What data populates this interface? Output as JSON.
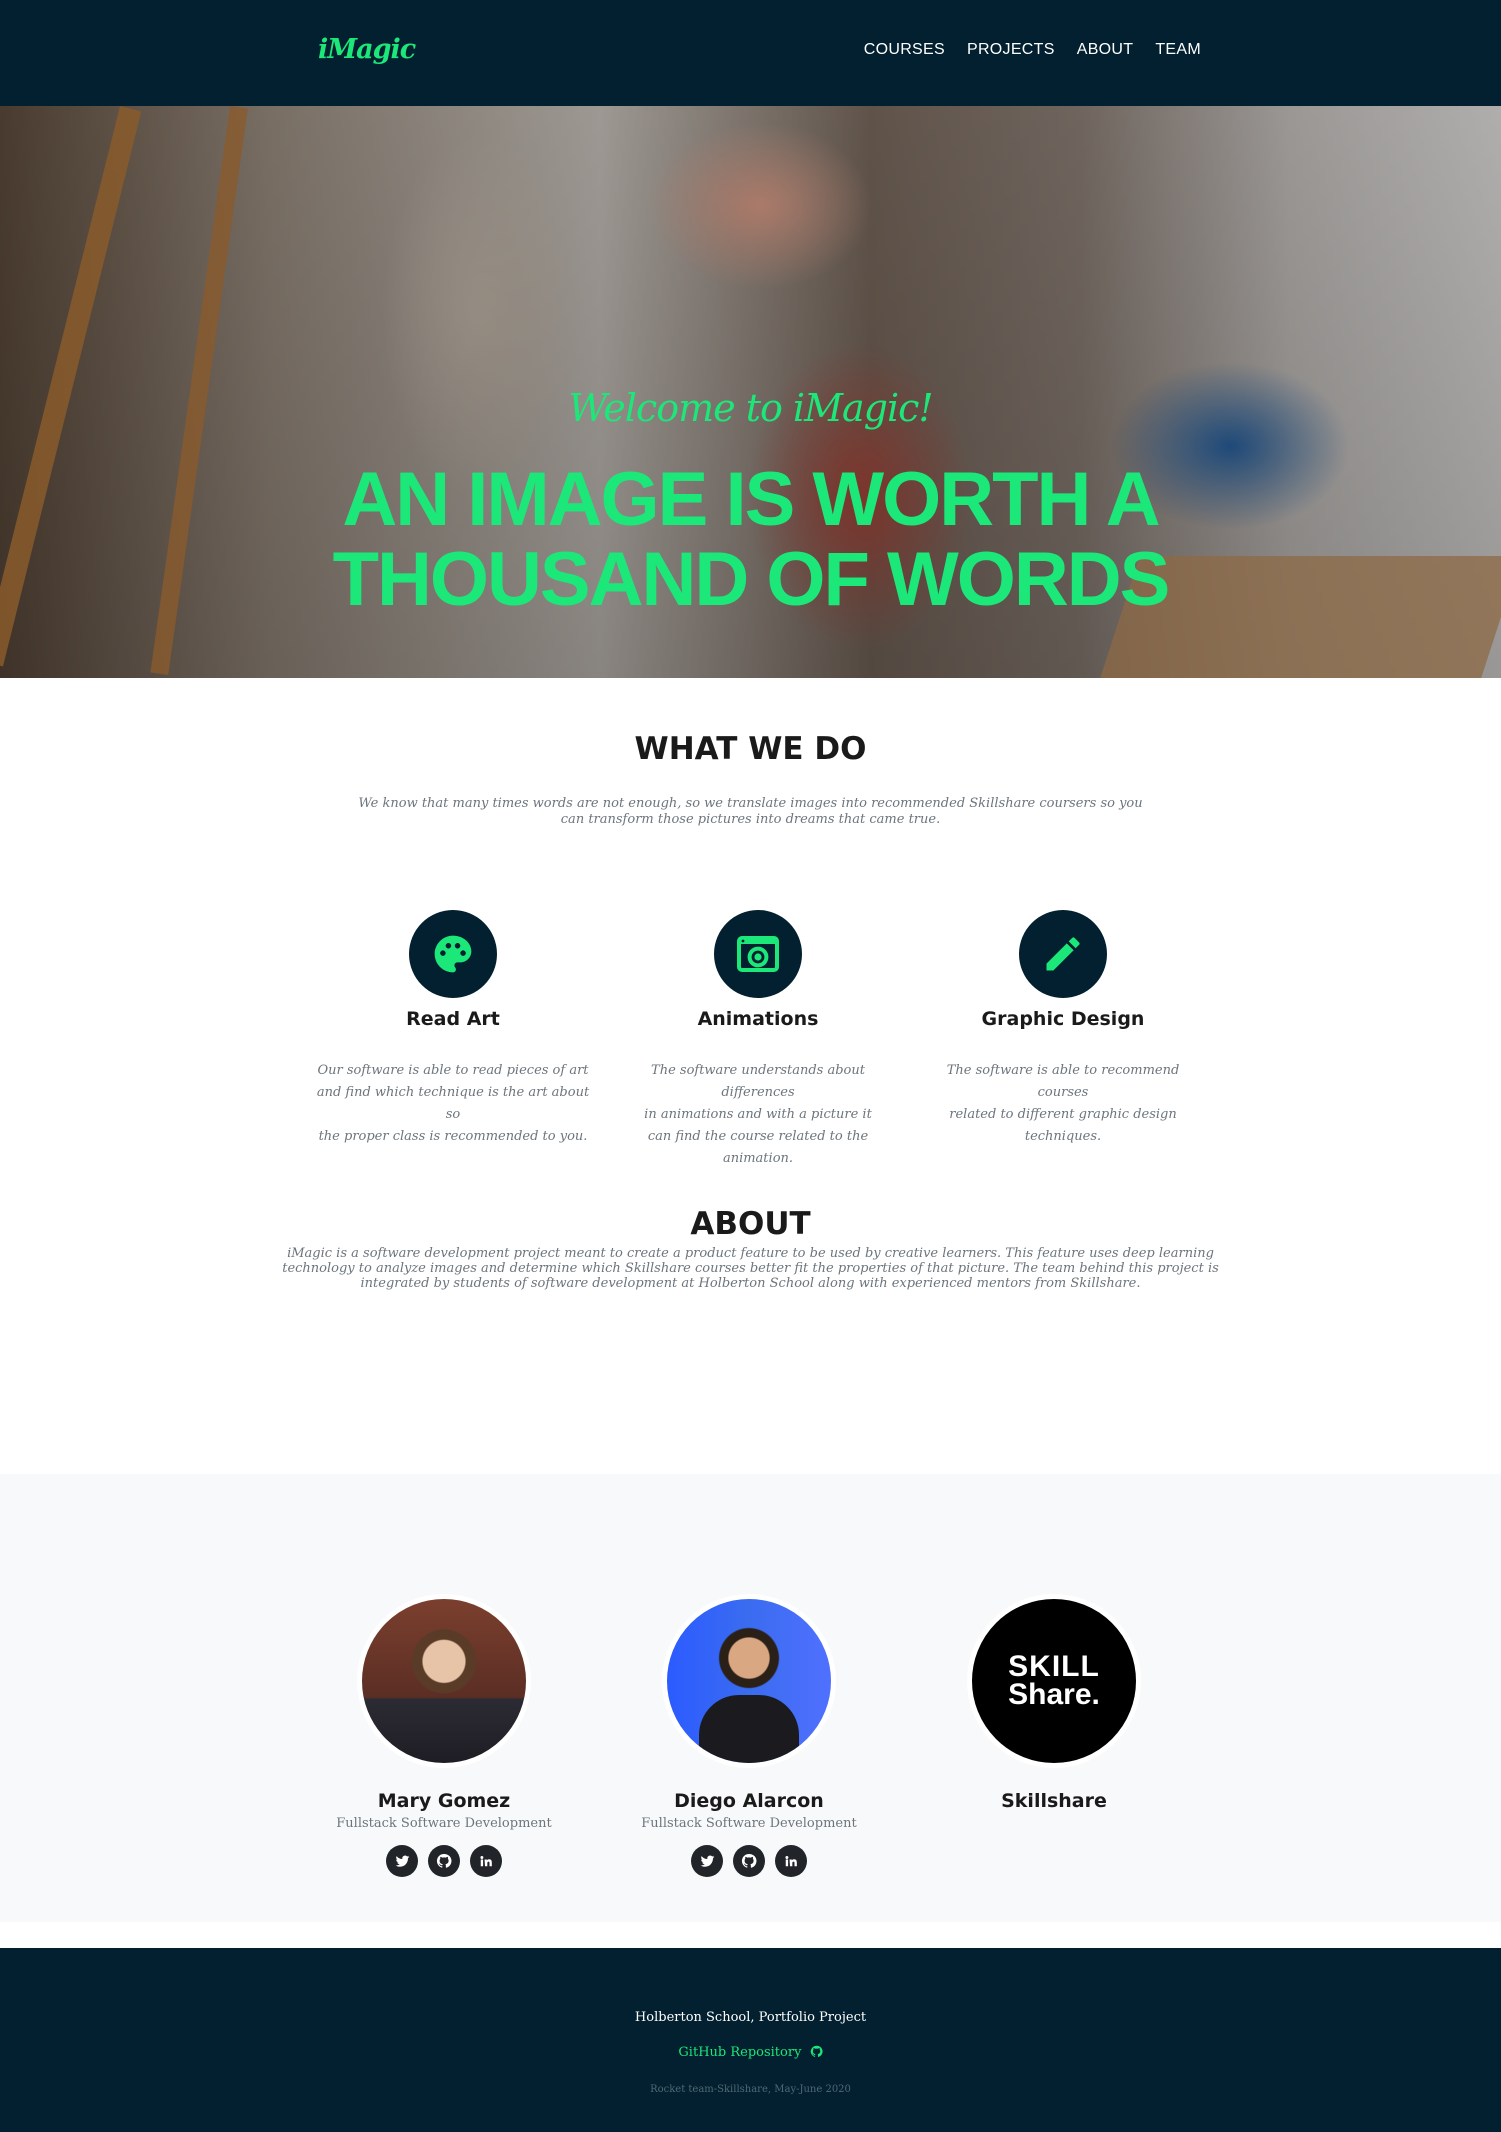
{
  "navbar": {
    "brand": "iMagic",
    "links": [
      "COURSES",
      "PROJECTS",
      "ABOUT",
      "TEAM"
    ]
  },
  "hero": {
    "subtitle": "Welcome to iMagic!",
    "title_line1": "AN IMAGE IS WORTH A",
    "title_line2": "THOUSAND OF WORDS"
  },
  "what_we_do": {
    "title": "WHAT WE DO",
    "text_line1": "We know that many times words are not enough, so we translate images into recommended Skillshare coursers so you",
    "text_line2": "can transform those pictures into dreams that came true.",
    "services": [
      {
        "title": "Read Art",
        "icon": "palette-icon",
        "lines": [
          "Our software is able to read pieces of art",
          "and find which technique is the art about so",
          "the proper class is recommended to you."
        ]
      },
      {
        "title": "Animations",
        "icon": "camera-icon",
        "lines": [
          "The software understands about differences",
          "in animations and with a picture it",
          "can find the course related to the animation."
        ]
      },
      {
        "title": "Graphic Design",
        "icon": "pencil-icon",
        "lines": [
          "The software is able to recommend courses",
          "related to different graphic design techniques."
        ]
      }
    ]
  },
  "about": {
    "title": "ABOUT",
    "line1": "iMagic is a software development project meant to create a product feature to be used by creative learners. This feature uses deep learning",
    "line2": "technology to analyze images and determine which Skillshare courses better fit the properties of that picture. The team behind this project is",
    "line3": "integrated by students of software development at Holberton School along with experienced mentors from Skillshare."
  },
  "team": {
    "members": [
      {
        "name": "Mary Gomez",
        "role": "Fullstack Software Development",
        "socials": [
          "twitter-icon",
          "github-icon",
          "linkedin-icon"
        ]
      },
      {
        "name": "Diego Alarcon",
        "role": "Fullstack Software Development",
        "socials": [
          "twitter-icon",
          "github-icon",
          "linkedin-icon"
        ]
      },
      {
        "name": "Skillshare",
        "logo_line1": "SKILL",
        "logo_line2": "Share."
      }
    ]
  },
  "footer": {
    "line1": "Holberton School, Portfolio Project",
    "link": "GitHub Repository",
    "copyright": "Rocket team-Skillshare, May-June 2020"
  },
  "colors": {
    "accent": "#1be879",
    "dark": "#02202f"
  }
}
